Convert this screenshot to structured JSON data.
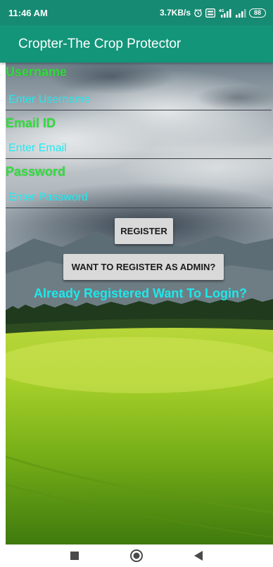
{
  "status_bar": {
    "time": "11:46 AM",
    "net_speed": "3.7KB/s",
    "battery": "88",
    "icons": [
      "alarm-icon",
      "volte-icon",
      "signal-4g-icon",
      "signal-icon",
      "battery-icon"
    ]
  },
  "app_bar": {
    "title": "Cropter-The Crop Protector"
  },
  "form": {
    "username_label": "Username",
    "username_placeholder": "Enter Username",
    "email_label": "Email ID",
    "email_placeholder": "Enter Email",
    "password_label": "Password",
    "password_placeholder": "Enter Password",
    "register_button": "REGISTER",
    "admin_button": "WANT TO REGISTER AS ADMIN?",
    "login_link": "Already Registered Want To Login?"
  },
  "nav_bar": {
    "icons": [
      "recents-square-icon",
      "home-circle-icon",
      "back-triangle-icon"
    ]
  },
  "colors": {
    "status_bar": "#168a72",
    "app_bar": "#13957a",
    "label_green": "#2fdc3a",
    "input_cyan": "#20f0f0",
    "button_gray": "#d9d9d9"
  }
}
